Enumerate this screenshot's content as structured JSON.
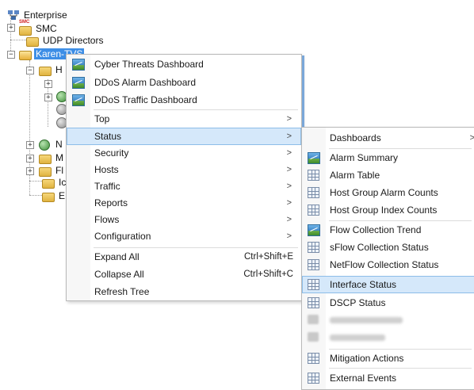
{
  "tree": {
    "enterprise": "Enterprise",
    "smc": "SMC",
    "smc_badge": "SMC",
    "udp_directors": "UDP Directors",
    "selected_host": "Karen-TVS",
    "partial_labels": [
      "H",
      "N",
      "M",
      "Fl",
      "Ic",
      "E"
    ]
  },
  "context_menu": {
    "items": [
      {
        "label": "Cyber Threats Dashboard",
        "icon": "chart-icon"
      },
      {
        "label": "DDoS Alarm Dashboard",
        "icon": "chart-icon"
      },
      {
        "label": "DDoS Traffic Dashboard",
        "icon": "chart-icon"
      },
      {
        "label": "Top",
        "arrow": ">"
      },
      {
        "label": "Status",
        "arrow": ">"
      },
      {
        "label": "Security",
        "arrow": ">"
      },
      {
        "label": "Hosts",
        "arrow": ">"
      },
      {
        "label": "Traffic",
        "arrow": ">"
      },
      {
        "label": "Reports",
        "arrow": ">"
      },
      {
        "label": "Flows",
        "arrow": ">"
      },
      {
        "label": "Configuration",
        "arrow": ">"
      },
      {
        "label": "Expand All",
        "shortcut": "Ctrl+Shift+E"
      },
      {
        "label": "Collapse All",
        "shortcut": "Ctrl+Shift+C"
      },
      {
        "label": "Refresh Tree"
      }
    ]
  },
  "status_submenu": {
    "items": [
      {
        "label": "Dashboards",
        "arrow": ">"
      },
      {
        "label": "Alarm Summary",
        "icon": "chart-icon"
      },
      {
        "label": "Alarm Table",
        "icon": "table-icon"
      },
      {
        "label": "Host Group Alarm Counts",
        "icon": "table-icon"
      },
      {
        "label": "Host Group Index Counts",
        "icon": "table-icon"
      },
      {
        "label": "Flow Collection Trend",
        "icon": "chart-icon"
      },
      {
        "label": "sFlow Collection Status",
        "icon": "table-icon"
      },
      {
        "label": "NetFlow Collection Status",
        "icon": "table-icon"
      },
      {
        "label": "Interface Status",
        "icon": "table-icon"
      },
      {
        "label": "DSCP Status",
        "icon": "table-icon"
      },
      {
        "label": "",
        "icon": "blurred-icon"
      },
      {
        "label": "",
        "icon": "blurred-icon"
      },
      {
        "label": "Mitigation Actions",
        "icon": "table-icon"
      },
      {
        "label": "External Events",
        "icon": "table-icon"
      }
    ]
  },
  "colors": {
    "selection": "#3d8ee6",
    "menu_highlight": "#d5e8fa",
    "menu_highlight_border": "#8dbde8"
  }
}
